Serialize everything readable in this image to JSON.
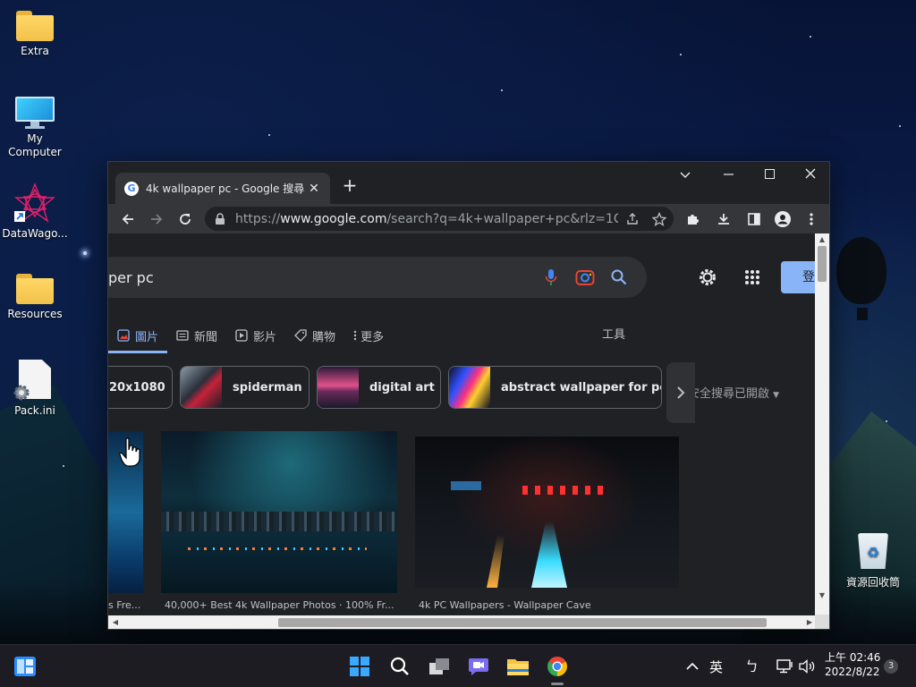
{
  "desktop": {
    "icons": [
      {
        "label": "Extra"
      },
      {
        "label": "My\nComputer"
      },
      {
        "label": "DataWago..."
      },
      {
        "label": "Resources"
      },
      {
        "label": "Pack.ini"
      }
    ],
    "recycle_bin": {
      "label": "資源回收筒"
    }
  },
  "browser": {
    "tab": {
      "title": "4k wallpaper pc - Google 搜尋",
      "close": "✕"
    },
    "new_tab": "+",
    "window_controls": {
      "dropdown": "⌄",
      "minimize": "—",
      "maximize": "☐",
      "close": "✕"
    },
    "address": {
      "scheme": "https://",
      "host": "www.google.com",
      "path": "/search?q=4k+wallpaper+pc&rlz=1C..."
    }
  },
  "page": {
    "search_query": "per pc",
    "signin_label": "登",
    "nav_tabs": [
      {
        "label": "圖片",
        "icon": "image-icon",
        "active": true
      },
      {
        "label": "新聞",
        "icon": "news-icon",
        "active": false
      },
      {
        "label": "影片",
        "icon": "video-icon",
        "active": false
      },
      {
        "label": "購物",
        "icon": "tag-icon",
        "active": false
      },
      {
        "label": "更多",
        "icon": "more-icon",
        "active": false
      }
    ],
    "tools_label": "工具",
    "safesearch_label": "安全搜尋已開啟",
    "chips": [
      {
        "label": "20x1080",
        "has_thumb": false
      },
      {
        "label": "spiderman",
        "has_thumb": true
      },
      {
        "label": "digital art",
        "has_thumb": true
      },
      {
        "label": "abstract wallpaper for pc",
        "has_thumb": true
      }
    ],
    "results": [
      {
        "caption": "s Fre..."
      },
      {
        "caption": "40,000+ Best 4k Wallpaper Photos · 100% Fr..."
      },
      {
        "caption": "4k PC Wallpapers - Wallpaper Cave"
      }
    ]
  },
  "taskbar": {
    "ime_label": "英",
    "ime_mode": "ㄅ",
    "clock_period_time": "上午 02:46",
    "clock_date": "2022/8/22",
    "notification_count": "3",
    "apps": [
      "start-icon",
      "search-icon",
      "task-view-icon",
      "chat-icon",
      "file-explorer-icon",
      "chrome-icon"
    ]
  },
  "colors": {
    "accent": "#8ab4f8",
    "page_bg": "#202124",
    "toolbar_bg": "#35363a",
    "taskbar_bg": "#1c1c22"
  }
}
